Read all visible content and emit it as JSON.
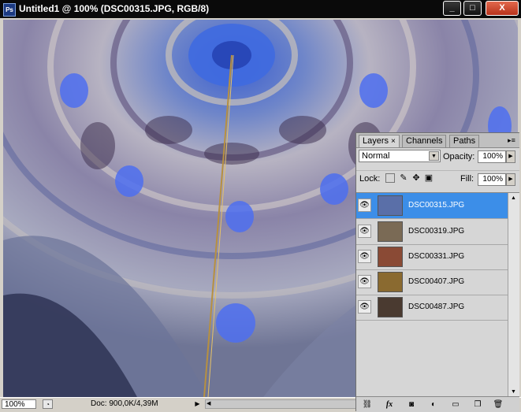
{
  "window": {
    "app_icon": "Ps",
    "title": "Untitled1 @ 100% (DSC00315.JPG, RGB/8)",
    "buttons": {
      "minimize": "_",
      "maximize": "□",
      "close": "X"
    }
  },
  "status_bar": {
    "zoom": "100%",
    "doc_info": "Doc: 900,0K/4,39M",
    "arrow_right": "▶",
    "arrow_left": "◀"
  },
  "layers_panel": {
    "tabs": [
      {
        "label": "Layers",
        "close": "×",
        "active": true
      },
      {
        "label": "Channels",
        "active": false
      },
      {
        "label": "Paths",
        "active": false
      }
    ],
    "menu_icon": "▸≡",
    "blend_mode": "Normal",
    "opacity_label": "Opacity:",
    "opacity_value": "100%",
    "lock_label": "Lock:",
    "fill_label": "Fill:",
    "fill_value": "100%",
    "layers": [
      {
        "name": "DSC00315.JPG",
        "selected": true,
        "thumb_color": "#5a6fa8"
      },
      {
        "name": "DSC00319.JPG",
        "selected": false,
        "thumb_color": "#7a6a55"
      },
      {
        "name": "DSC00331.JPG",
        "selected": false,
        "thumb_color": "#8a4a35"
      },
      {
        "name": "DSC00407.JPG",
        "selected": false,
        "thumb_color": "#8a6a30"
      },
      {
        "name": "DSC00487.JPG",
        "selected": false,
        "thumb_color": "#4a3a30"
      }
    ],
    "bottom_icons": [
      "link-icon",
      "fx-icon",
      "mask-icon",
      "adjustment-icon",
      "group-icon",
      "new-layer-icon",
      "trash-icon"
    ],
    "fx_label": "fx"
  },
  "colors": {
    "selection": "#3c8ee8",
    "titlebar": "#0a0a0a"
  }
}
